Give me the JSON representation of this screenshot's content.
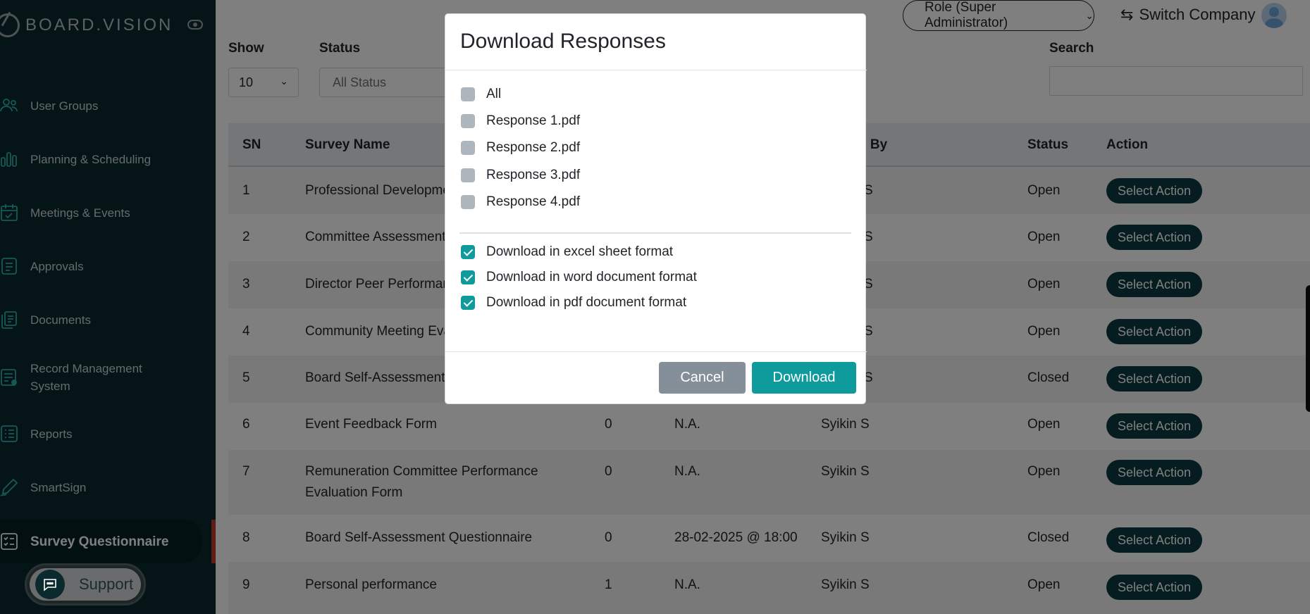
{
  "app": {
    "logo_text": "BOARD.VISION"
  },
  "sidebar": {
    "items": [
      {
        "label": "User Groups",
        "icon": "users-icon"
      },
      {
        "label": "Planning & Scheduling",
        "icon": "bar-chart-icon"
      },
      {
        "label": "Meetings & Events",
        "icon": "calendar-check-icon"
      },
      {
        "label": "Approvals",
        "icon": "document-lines-icon"
      },
      {
        "label": "Documents",
        "icon": "documents-icon"
      },
      {
        "label": "Record Management System",
        "icon": "records-icon"
      },
      {
        "label": "Reports",
        "icon": "list-icon"
      },
      {
        "label": "SmartSign",
        "icon": "pen-icon"
      },
      {
        "label": "Survey Questionnaire",
        "icon": "checklist-icon",
        "active": true
      }
    ],
    "support_label": "Support"
  },
  "header": {
    "role_label": "Role (Super Administrator)",
    "switch_company_label": "Switch Company"
  },
  "filters": {
    "show_label": "Show",
    "show_value": "10",
    "status_label": "Status",
    "status_value": "All Status",
    "search_label": "Search",
    "search_value": ""
  },
  "table": {
    "headers": {
      "sn": "SN",
      "survey_name": "Survey Name",
      "created_by": "d By",
      "status": "Status",
      "action": "Action"
    },
    "rows": [
      {
        "sn": "1",
        "name": "Professional Development",
        "responses": "",
        "deadline": "",
        "created_by": "S",
        "status": "Open",
        "action": "Select Action"
      },
      {
        "sn": "2",
        "name": "Committee Assessment - J",
        "responses": "",
        "deadline": "",
        "created_by": "S",
        "status": "Open",
        "action": "Select Action"
      },
      {
        "sn": "3",
        "name": "Director Peer Performance",
        "responses": "",
        "deadline": "",
        "created_by": "S",
        "status": "Open",
        "action": "Select Action"
      },
      {
        "sn": "4",
        "name": "Community Meeting Evalu",
        "responses": "",
        "deadline": "",
        "created_by": "S",
        "status": "Open",
        "action": "Select Action"
      },
      {
        "sn": "5",
        "name": "Board Self-Assessment Q",
        "responses": "",
        "deadline": "",
        "created_by": "S",
        "status": "Closed",
        "action": "Select Action"
      },
      {
        "sn": "6",
        "name": "Event Feedback Form",
        "responses": "0",
        "deadline": "N.A.",
        "created_by": "Syikin S",
        "status": "Open",
        "action": "Select Action"
      },
      {
        "sn": "7",
        "name": "Remuneration Committee Performance Evaluation Form",
        "responses": "0",
        "deadline": "N.A.",
        "created_by": "Syikin S",
        "status": "Open",
        "action": "Select Action"
      },
      {
        "sn": "8",
        "name": "Board Self-Assessment Questionnaire",
        "responses": "0",
        "deadline": "28-02-2025 @ 18:00",
        "created_by": "Syikin S",
        "status": "Closed",
        "action": "Select Action"
      },
      {
        "sn": "9",
        "name": "Personal performance",
        "responses": "1",
        "deadline": "N.A.",
        "created_by": "Syikin S",
        "status": "Open",
        "action": "Select Action"
      }
    ]
  },
  "modal": {
    "title": "Download Responses",
    "files": [
      {
        "label": "All",
        "checked": false
      },
      {
        "label": "Response 1.pdf",
        "checked": false
      },
      {
        "label": "Response 2.pdf",
        "checked": false
      },
      {
        "label": "Response 3.pdf",
        "checked": false
      },
      {
        "label": "Response 4.pdf",
        "checked": false
      }
    ],
    "formats": [
      {
        "label": "Download in excel sheet format",
        "checked": true
      },
      {
        "label": "Download in word document format",
        "checked": true
      },
      {
        "label": "Download in pdf document format",
        "checked": true
      }
    ],
    "cancel_label": "Cancel",
    "download_label": "Download"
  },
  "colors": {
    "sidebar_bg": "#0b2a2e",
    "accent": "#0f9a9c",
    "action_button": "#0b3b40",
    "active_indicator": "#c0392b"
  }
}
